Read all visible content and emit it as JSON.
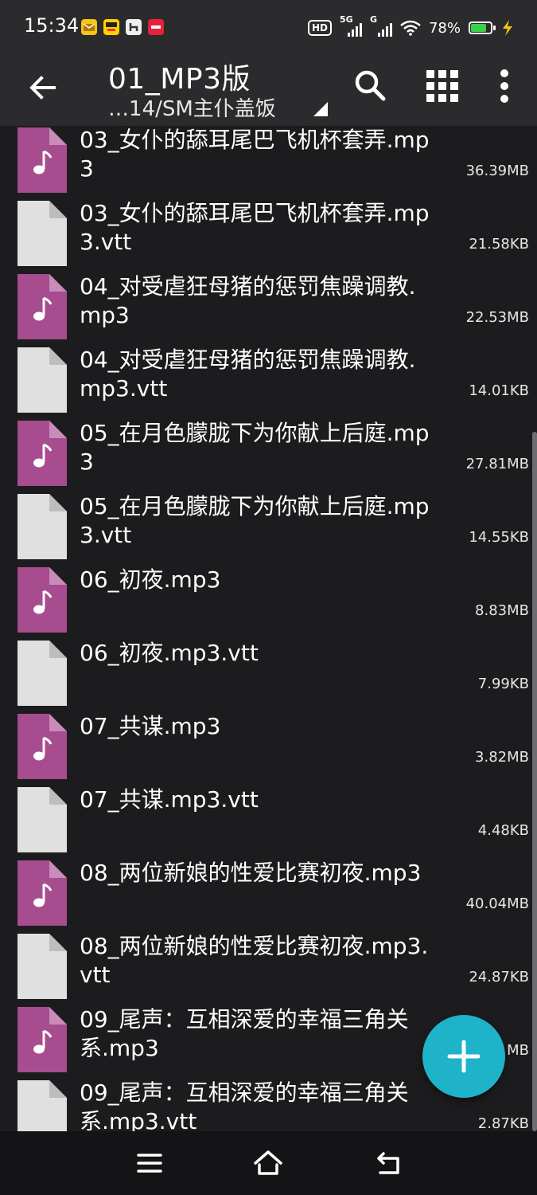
{
  "status_bar": {
    "time": "15:34",
    "hd_label": "HD",
    "signal1_label": "5G",
    "signal2_label": "G",
    "battery": "78%",
    "battery_level": 0.78,
    "icons": [
      "mail-app-icon",
      "meituan-app-icon",
      "game-app-icon",
      "red-app-icon",
      "wifi-icon",
      "battery-icon",
      "charging-icon"
    ]
  },
  "app_bar": {
    "title": "01_MP3版",
    "subtitle": "…14/SM主仆盖饭"
  },
  "files": [
    {
      "name": "03_女仆的舔耳尾巴飞机杯套弄.mp3",
      "size": "36.39MB",
      "type": "audio"
    },
    {
      "name": "03_女仆的舔耳尾巴飞机杯套弄.mp3.vtt",
      "size": "21.58KB",
      "type": "text"
    },
    {
      "name": "04_对受虐狂母猪的惩罚焦躁调教.mp3",
      "size": "22.53MB",
      "type": "audio"
    },
    {
      "name": "04_对受虐狂母猪的惩罚焦躁调教.mp3.vtt",
      "size": "14.01KB",
      "type": "text"
    },
    {
      "name": "05_在月色朦胧下为你献上后庭.mp3",
      "size": "27.81MB",
      "type": "audio"
    },
    {
      "name": "05_在月色朦胧下为你献上后庭.mp3.vtt",
      "size": "14.55KB",
      "type": "text"
    },
    {
      "name": "06_初夜.mp3",
      "size": "8.83MB",
      "type": "audio"
    },
    {
      "name": "06_初夜.mp3.vtt",
      "size": "7.99KB",
      "type": "text"
    },
    {
      "name": "07_共谋.mp3",
      "size": "3.82MB",
      "type": "audio"
    },
    {
      "name": "07_共谋.mp3.vtt",
      "size": "4.48KB",
      "type": "text"
    },
    {
      "name": "08_两位新娘的性爱比赛初夜.mp3",
      "size": "40.04MB",
      "type": "audio"
    },
    {
      "name": "08_两位新娘的性爱比赛初夜.mp3.vtt",
      "size": "24.87KB",
      "type": "text"
    },
    {
      "name": "09_尾声：互相深爱的幸福三角关系.mp3",
      "size": "MB",
      "type": "audio"
    },
    {
      "name": "09_尾声：互相深爱的幸福三角关系.mp3.vtt",
      "size": "2.87KB",
      "type": "text"
    }
  ],
  "colors": {
    "audio_icon": "#a64c8f",
    "audio_icon_fold": "#c98bb8",
    "text_icon": "#e0e0e0",
    "text_icon_fold": "#bdbdbd",
    "fab": "#1fb3c9",
    "background": "#1c1c1e",
    "bar": "#2b2b2d"
  }
}
